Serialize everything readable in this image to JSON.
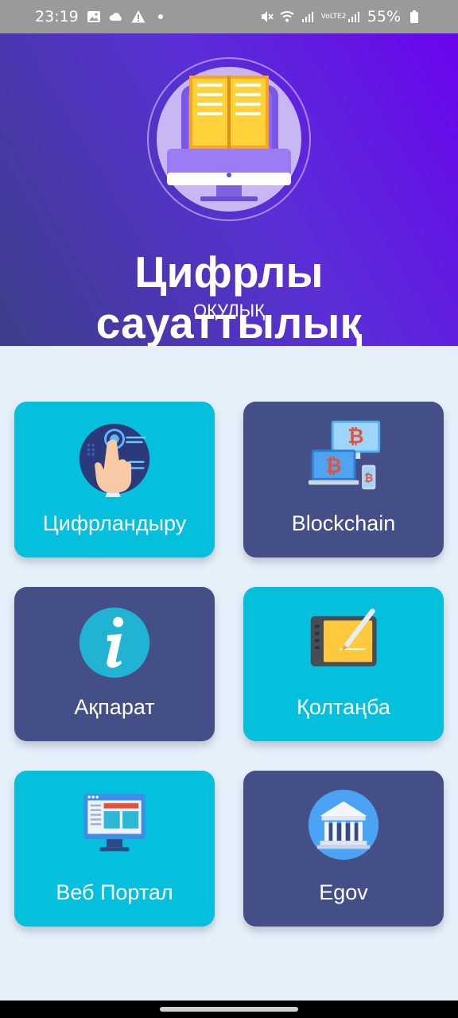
{
  "status_bar": {
    "time": "23:19",
    "battery": "55%",
    "network": "VoLTE2",
    "icons": [
      "image-icon",
      "cloud-icon",
      "warning-icon",
      "dot-icon",
      "mute-icon",
      "wifi-icon",
      "signal-icon",
      "battery-icon"
    ]
  },
  "header": {
    "title": "Цифрлы сауаттылық",
    "subtitle": "ОҚУЛЫҚ",
    "logo_icon": "book-on-monitor-icon"
  },
  "menu": [
    {
      "label": "Цифрландыру",
      "icon": "touch-hand-icon",
      "color": "#05c0dc"
    },
    {
      "label": "Blockchain",
      "icon": "bitcoin-devices-icon",
      "color": "#434f86"
    },
    {
      "label": "Ақпарат",
      "icon": "info-icon",
      "color": "#434f86"
    },
    {
      "label": "Қолтаңба",
      "icon": "signature-tablet-icon",
      "color": "#05c0dc"
    },
    {
      "label": "Веб Портал",
      "icon": "web-portal-icon",
      "color": "#05c0dc"
    },
    {
      "label": "Egov",
      "icon": "government-building-icon",
      "color": "#434f86"
    }
  ],
  "colors": {
    "background": "#e6f0fb",
    "header_start": "#3c3f8a",
    "header_end": "#6a05ee",
    "cyan": "#05c0dc",
    "navy": "#434f86"
  }
}
